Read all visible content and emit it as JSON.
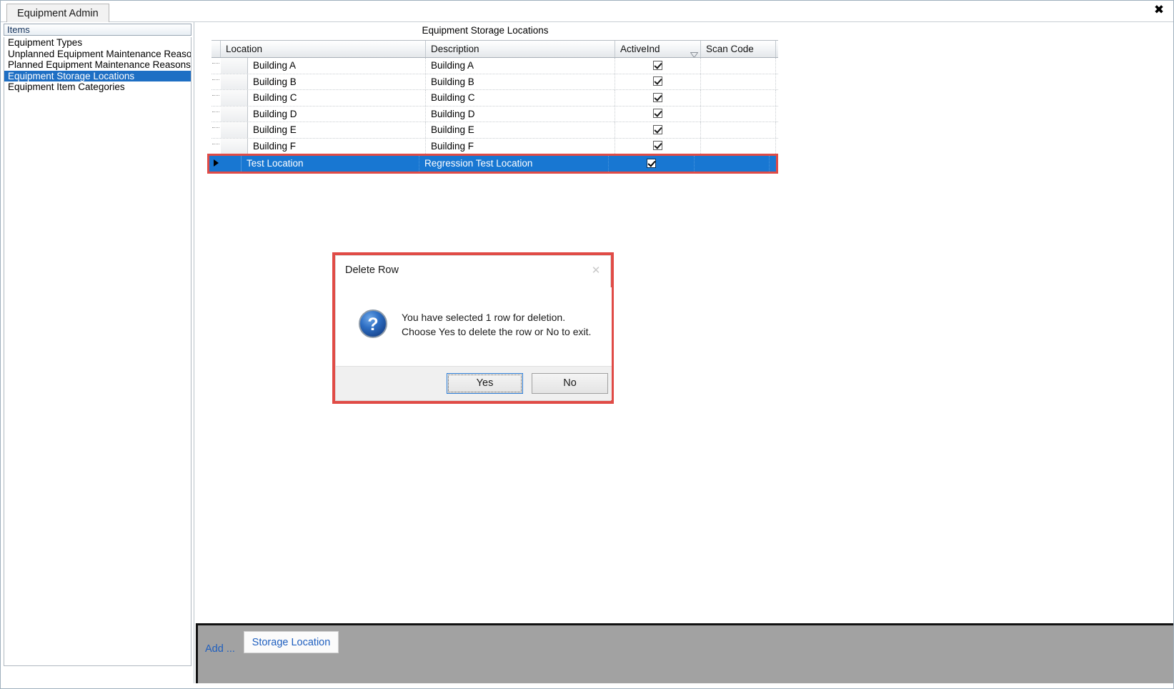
{
  "window": {
    "tab_label": "Equipment Admin",
    "close_icon": "close-icon",
    "close_glyph": "✖"
  },
  "sidebar": {
    "header": "Items",
    "items": [
      {
        "label": "Equipment Types",
        "selected": false
      },
      {
        "label": "Unplanned Equipment Maintenance Reasons",
        "selected": false
      },
      {
        "label": "Planned Equipment Maintenance Reasons",
        "selected": false
      },
      {
        "label": "Equipment Storage Locations",
        "selected": true
      },
      {
        "label": "Equipment Item Categories",
        "selected": false
      }
    ]
  },
  "grid": {
    "title": "Equipment Storage Locations",
    "columns": [
      {
        "key": "location",
        "label": "Location"
      },
      {
        "key": "description",
        "label": "Description"
      },
      {
        "key": "activeind",
        "label": "ActiveInd",
        "sorted": true,
        "sort_icon": "sort-descending-icon"
      },
      {
        "key": "scancode",
        "label": "Scan Code"
      }
    ],
    "rows": [
      {
        "location": "Building A",
        "description": "Building A",
        "activeind": true,
        "scancode": "",
        "selected": false
      },
      {
        "location": "Building B",
        "description": "Building B",
        "activeind": true,
        "scancode": "",
        "selected": false
      },
      {
        "location": "Building C",
        "description": "Building C",
        "activeind": true,
        "scancode": "",
        "selected": false
      },
      {
        "location": "Building D",
        "description": "Building D",
        "activeind": true,
        "scancode": "",
        "selected": false
      },
      {
        "location": "Building E",
        "description": "Building E",
        "activeind": true,
        "scancode": "",
        "selected": false
      },
      {
        "location": "Building F",
        "description": "Building F",
        "activeind": true,
        "scancode": "",
        "selected": false
      },
      {
        "location": "Test Location",
        "description": "Regression Test Location",
        "activeind": true,
        "scancode": "",
        "selected": true
      }
    ]
  },
  "command_bar": {
    "add_label": "Add ...",
    "storage_button": "Storage Location"
  },
  "dialog": {
    "title": "Delete Row",
    "close_icon": "close-icon",
    "close_glyph": "✕",
    "icon": "question-mark-icon",
    "message_line1": "You have selected 1 row for deletion.",
    "message_line2": "Choose Yes to delete the row or No to exit.",
    "yes_label": "Yes",
    "no_label": "No"
  },
  "colors": {
    "selection_blue": "#1877d2",
    "highlight_red": "#e04b46",
    "link_blue": "#1f5fbf",
    "command_bar_gray": "#a2a2a2"
  }
}
